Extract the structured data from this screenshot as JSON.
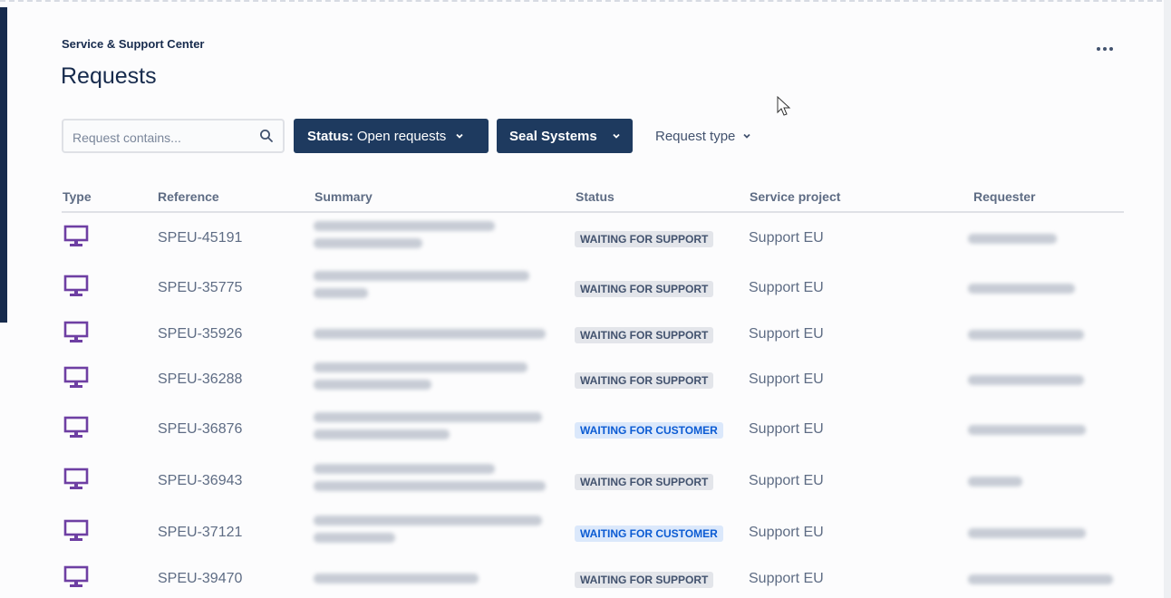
{
  "header": {
    "breadcrumb": "Service & Support Center",
    "title": "Requests"
  },
  "filters": {
    "search_placeholder": "Request contains...",
    "status_label": "Status:",
    "status_value": "Open requests",
    "org_label": "Seal Systems",
    "type_label": "Request type"
  },
  "table": {
    "columns": [
      "Type",
      "Reference",
      "Summary",
      "Status",
      "Service project",
      "Requester"
    ],
    "rows": [
      {
        "reference": "SPEU-45191",
        "status": "WAITING FOR SUPPORT",
        "project": "Support EU"
      },
      {
        "reference": "SPEU-35775",
        "status": "WAITING FOR SUPPORT",
        "project": "Support EU"
      },
      {
        "reference": "SPEU-35926",
        "status": "WAITING FOR SUPPORT",
        "project": "Support EU"
      },
      {
        "reference": "SPEU-36288",
        "status": "WAITING FOR SUPPORT",
        "project": "Support EU"
      },
      {
        "reference": "SPEU-36876",
        "status": "WAITING FOR CUSTOMER",
        "project": "Support EU"
      },
      {
        "reference": "SPEU-36943",
        "status": "WAITING FOR SUPPORT",
        "project": "Support EU"
      },
      {
        "reference": "SPEU-37121",
        "status": "WAITING FOR CUSTOMER",
        "project": "Support EU"
      },
      {
        "reference": "SPEU-39470",
        "status": "WAITING FOR SUPPORT",
        "project": "Support EU"
      }
    ]
  },
  "icons": {
    "type": "monitor-icon",
    "search": "search-icon",
    "more": "more-icon",
    "chevron": "chevron-down-icon"
  },
  "colors": {
    "primary_dark": "#1e3a5f",
    "type_icon": "#6e3fa3",
    "status_support_bg": "#e3e5ea",
    "status_customer_bg": "#dbe8fb",
    "status_customer_text": "#0b5bd3"
  }
}
